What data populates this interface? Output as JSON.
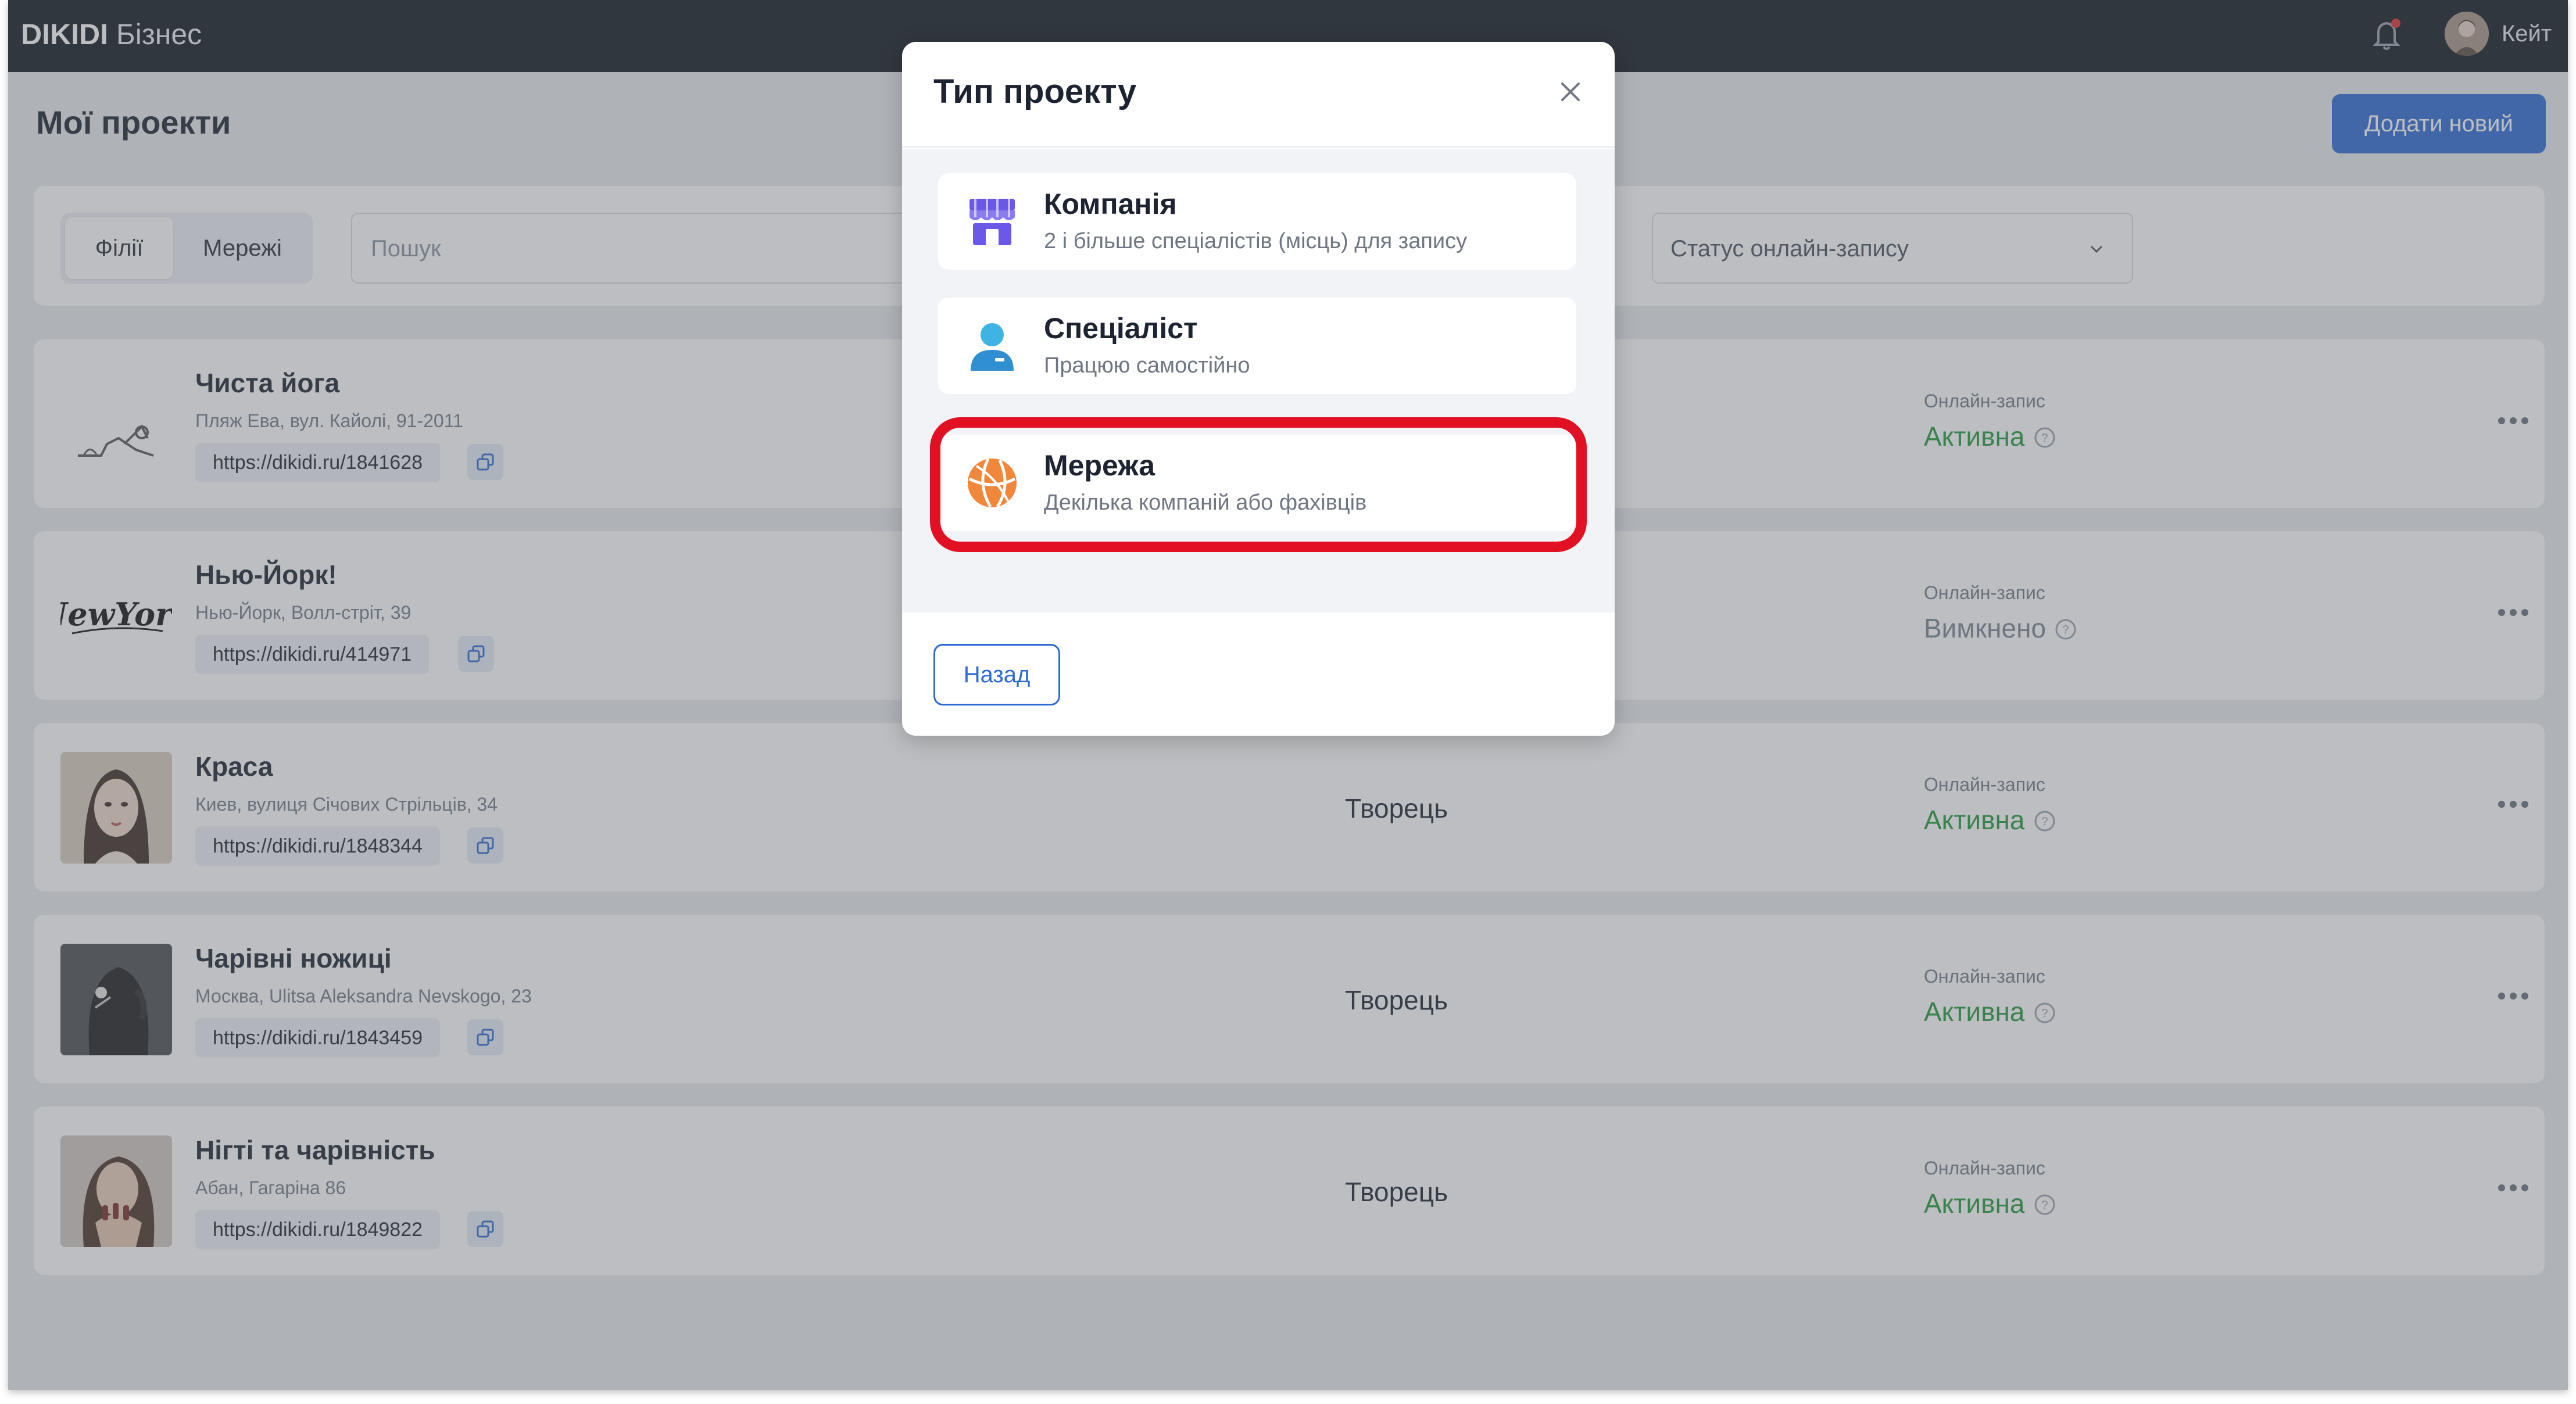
{
  "header": {
    "brand_name": "DIKIDI",
    "brand_suffix": "Бізнес",
    "user_name": "Кейт"
  },
  "page": {
    "title": "Мої проекти",
    "add_button": "Додати новий"
  },
  "filters": {
    "tabs": [
      "Філії",
      "Мережі"
    ],
    "search_placeholder": "Пошук",
    "status_select": "Статус онлайн-запису"
  },
  "projects": [
    {
      "name": "Чиста йога",
      "address": "Пляж Ева, вул. Кайолі, 91-2011",
      "link": "https://dikidi.ru/1841628",
      "role": "",
      "online_label": "Онлайн-запис",
      "online_status": "Активна"
    },
    {
      "name": "Нью-Йорк!",
      "address": "Нью-Йорк, Волл-стріт, 39",
      "link": "https://dikidi.ru/414971",
      "role": "",
      "online_label": "Онлайн-запис",
      "online_status": "Вимкнено"
    },
    {
      "name": "Краса",
      "address": "Киев, вулиця Січових Стрільців, 34",
      "link": "https://dikidi.ru/1848344",
      "role": "Творець",
      "online_label": "Онлайн-запис",
      "online_status": "Активна"
    },
    {
      "name": "Чарівні ножиці",
      "address": "Москва, Ulitsa Aleksandra Nevskogo, 23",
      "link": "https://dikidi.ru/1843459",
      "role": "Творець",
      "online_label": "Онлайн-запис",
      "online_status": "Активна"
    },
    {
      "name": "Нігті та чарівність",
      "address": "Абан, Гагаріна 86",
      "link": "https://dikidi.ru/1849822",
      "role": "Творець",
      "online_label": "Онлайн-запис",
      "online_status": "Активна"
    }
  ],
  "modal": {
    "title": "Тип проекту",
    "options": [
      {
        "title": "Компанія",
        "subtitle": "2 і більше спеціалістів (місць) для запису",
        "icon": "storefront-icon"
      },
      {
        "title": "Спеціаліст",
        "subtitle": "Працюю самостійно",
        "icon": "person-icon"
      },
      {
        "title": "Мережа",
        "subtitle": "Декілька компаній або фахівців",
        "icon": "network-ball-icon"
      }
    ],
    "back_button": "Назад"
  },
  "colors": {
    "topbar": "#101720",
    "accent": "#2d6ad4",
    "active_status": "#1f9a3a",
    "highlight": "#e11022"
  }
}
